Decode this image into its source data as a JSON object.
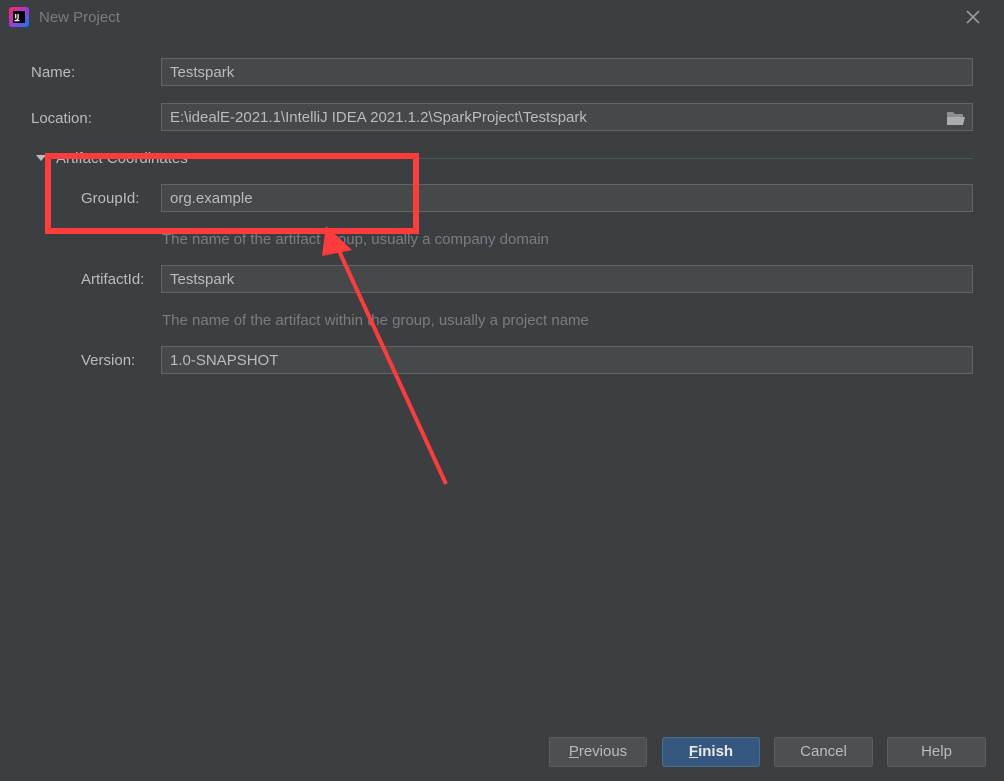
{
  "window": {
    "title": "New Project"
  },
  "form": {
    "name_label": "Name:",
    "name_value": "Testspark",
    "location_label": "Location:",
    "location_value": "E:\\idealE-2021.1\\IntelliJ IDEA 2021.1.2\\SparkProject\\Testspark",
    "section_title": "Artifact Coordinates",
    "groupid_label": "GroupId:",
    "groupid_value": "org.example",
    "groupid_hint": "The name of the artifact group, usually a company domain",
    "artifactid_label": "ArtifactId:",
    "artifactid_value": "Testspark",
    "artifactid_hint": "The name of the artifact within the group, usually a project name",
    "version_label": "Version:",
    "version_value": "1.0-SNAPSHOT"
  },
  "buttons": {
    "previous_first": "P",
    "previous_rest": "revious",
    "finish_first": "F",
    "finish_rest": "inish",
    "cancel": "Cancel",
    "help": "Help"
  },
  "icons": {
    "app": "intellij-idea-icon",
    "close": "close-icon",
    "folder": "folder-open-icon",
    "section_toggle": "triangle-down-icon"
  },
  "colors": {
    "background": "#3c3f41",
    "field_bg": "#45494a",
    "primary_button": "#365880",
    "annotation": "#ff3b3b"
  }
}
